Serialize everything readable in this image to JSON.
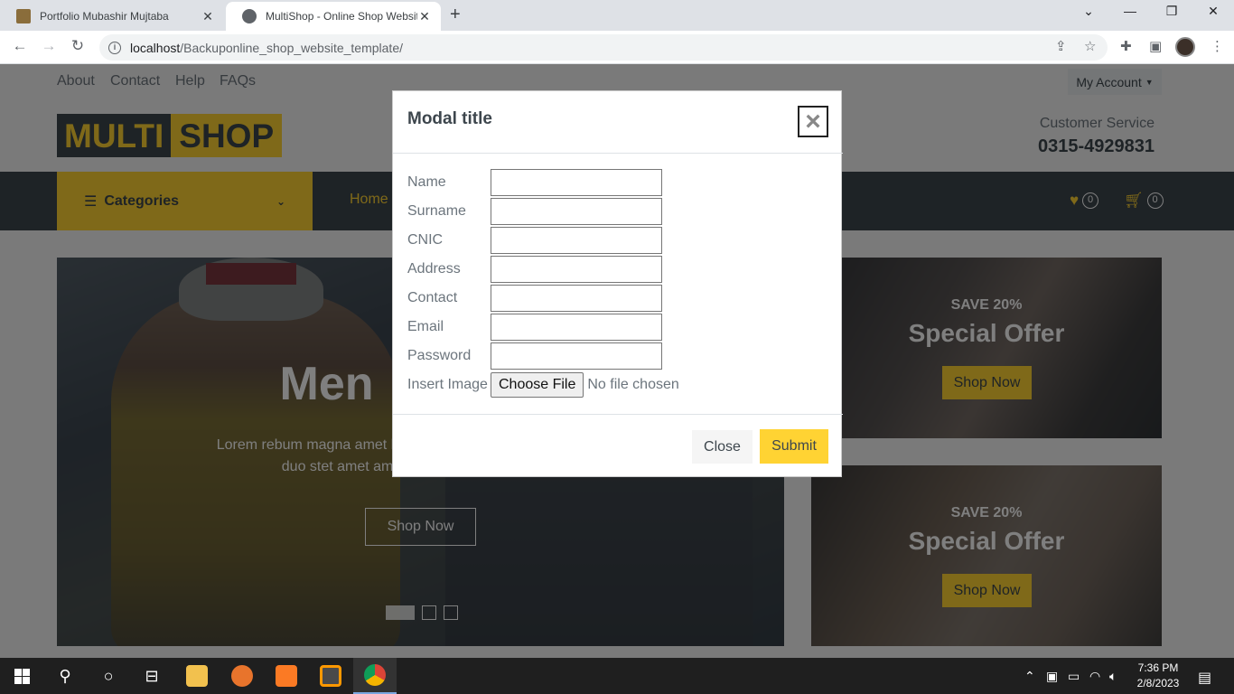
{
  "browser": {
    "tabs": [
      {
        "title": "Portfolio Mubashir Mujtaba"
      },
      {
        "title": "MultiShop - Online Shop Website"
      }
    ],
    "url_host": "localhost",
    "url_path": "/Backuponline_shop_website_template/"
  },
  "site": {
    "top_links": [
      "About",
      "Contact",
      "Help",
      "FAQs"
    ],
    "my_account": "My Account",
    "logo": {
      "part1": "MULTI",
      "part2": "SHOP"
    },
    "customer_service": {
      "label": "Customer Service",
      "phone": "0315-4929831"
    },
    "nav": {
      "categories": "Categories",
      "home": "Home",
      "wishlist_count": "0",
      "cart_count": "0"
    },
    "hero": {
      "title": "Men",
      "text": "Lorem rebum magna amet lorem magna erat diam stet. Sadips duo stet amet amet ndiam elitr ipsum diam",
      "button": "Shop Now"
    },
    "offers": [
      {
        "save": "SAVE 20%",
        "title": "Special Offer",
        "button": "Shop Now"
      },
      {
        "save": "SAVE 20%",
        "title": "Special Offer",
        "button": "Shop Now"
      }
    ]
  },
  "modal": {
    "title": "Modal title",
    "close_symbol": "×",
    "fields": [
      {
        "label": "Name",
        "value": ""
      },
      {
        "label": "Surname",
        "value": ""
      },
      {
        "label": "CNIC",
        "value": ""
      },
      {
        "label": "Address",
        "value": ""
      },
      {
        "label": "Contact",
        "value": ""
      },
      {
        "label": "Email",
        "value": ""
      },
      {
        "label": "Password",
        "value": ""
      }
    ],
    "image_field": {
      "label": "Insert Image",
      "button": "Choose File",
      "status": "No file chosen"
    },
    "close_button": "Close",
    "submit_button": "Submit"
  },
  "taskbar": {
    "time": "7:36 PM",
    "date": "2/8/2023"
  },
  "colors": {
    "primary": "#ffd333",
    "dark": "#3d464d",
    "light": "#f5f5f5"
  }
}
